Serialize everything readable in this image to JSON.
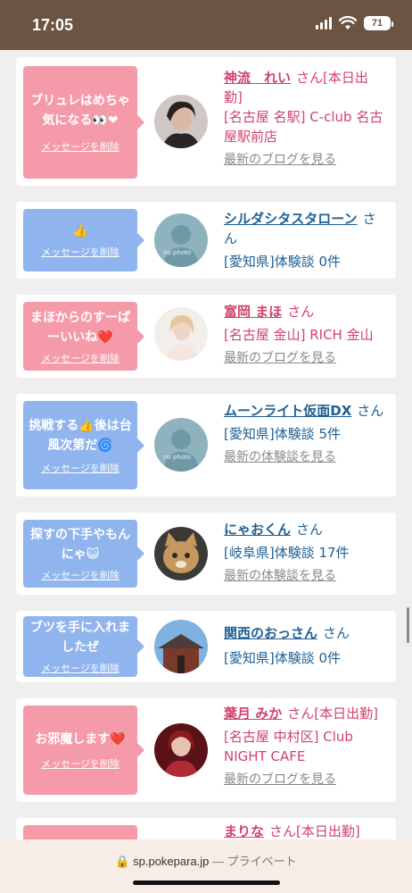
{
  "status_bar": {
    "time": "17:05",
    "battery": "71"
  },
  "messages": [
    {
      "theme": "pink",
      "message": "ブリュレはめちゃ気になる👀❤",
      "delete_label": "メッセージを削除",
      "name": "神流　れい",
      "suffix": "さん",
      "tag": "[本日出勤]",
      "detail": "[名古屋 名駅] C-club 名古屋駅前店",
      "link": "最新のブログを見る",
      "avatar": "woman-photo"
    },
    {
      "theme": "blue",
      "message": "👍",
      "delete_label": "メッセージを削除",
      "name": "シルダシタスタローン",
      "suffix": "さん",
      "tag": "",
      "detail": "[愛知県]体験談 0件",
      "link": "",
      "avatar": "no-photo"
    },
    {
      "theme": "pink",
      "message": "まほからのすーぱーいいね❤️",
      "delete_label": "メッセージを削除",
      "name": "富岡 まほ",
      "suffix": "さん",
      "tag": "",
      "detail": "[名古屋 金山] RICH 金山",
      "link": "最新のブログを見る",
      "avatar": "woman-photo"
    },
    {
      "theme": "blue",
      "message": "挑戦する👍後は台風次第だ🌀",
      "delete_label": "メッセージを削除",
      "name": "ムーンライト仮面DX",
      "suffix": "さん",
      "tag": "",
      "detail": "[愛知県]体験談 5件",
      "link": "最新の体験談を見る",
      "avatar": "no-photo"
    },
    {
      "theme": "blue",
      "message": "探すの下手やもんにゃ😺",
      "delete_label": "メッセージを削除",
      "name": "にゃおくん",
      "suffix": "さん",
      "tag": "",
      "detail": "[岐阜県]体験談 17件",
      "link": "最新の体験談を見る",
      "avatar": "cat-photo"
    },
    {
      "theme": "blue",
      "message": "ブツを手に入れましたぜ",
      "delete_label": "メッセージを削除",
      "name": "関西のおっさん",
      "suffix": "さん",
      "tag": "",
      "detail": "[愛知県]体験談 0件",
      "link": "",
      "avatar": "temple-photo"
    },
    {
      "theme": "pink",
      "message": "お邪魔します❤️",
      "delete_label": "メッセージを削除",
      "name": "葉月 みか",
      "suffix": "さん",
      "tag": "[本日出勤]",
      "detail": "[名古屋 中村区] Club NIGHT CAFE",
      "link": "最新のブログを見る",
      "avatar": "woman-photo"
    },
    {
      "theme": "pink",
      "message": "",
      "delete_label": "",
      "name": "まりな",
      "suffix": "さん",
      "tag": "[本日出勤]",
      "detail": "",
      "link": "",
      "avatar": ""
    }
  ],
  "avatar_text": {
    "no_photo": "no photo"
  },
  "browser": {
    "domain": "sp.pokepara.jp",
    "separator": "—",
    "mode": "プライベート"
  }
}
